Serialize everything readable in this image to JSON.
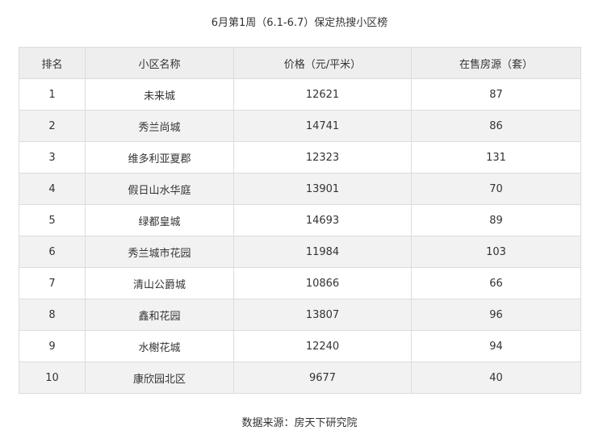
{
  "title": "6月第1周（6.1-6.7）保定热搜小区榜",
  "table": {
    "headers": [
      "排名",
      "小区名称",
      "价格（元/平米）",
      "在售房源（套）"
    ],
    "rows": [
      [
        "1",
        "未来城",
        "12621",
        "87"
      ],
      [
        "2",
        "秀兰尚城",
        "14741",
        "86"
      ],
      [
        "3",
        "维多利亚夏郡",
        "12323",
        "131"
      ],
      [
        "4",
        "假日山水华庭",
        "13901",
        "70"
      ],
      [
        "5",
        "绿都皇城",
        "14693",
        "89"
      ],
      [
        "6",
        "秀兰城市花园",
        "11984",
        "103"
      ],
      [
        "7",
        "清山公爵城",
        "10866",
        "66"
      ],
      [
        "8",
        "鑫和花园",
        "13807",
        "96"
      ],
      [
        "9",
        "水榭花城",
        "12240",
        "94"
      ],
      [
        "10",
        "康欣园北区",
        "9677",
        "40"
      ]
    ]
  },
  "source": "数据来源：房天下研究院",
  "colors": {
    "header_bg": "#eeeeee",
    "stripe_bg": "#f2f2f2",
    "border": "#dcdcdc",
    "text": "#333333"
  }
}
